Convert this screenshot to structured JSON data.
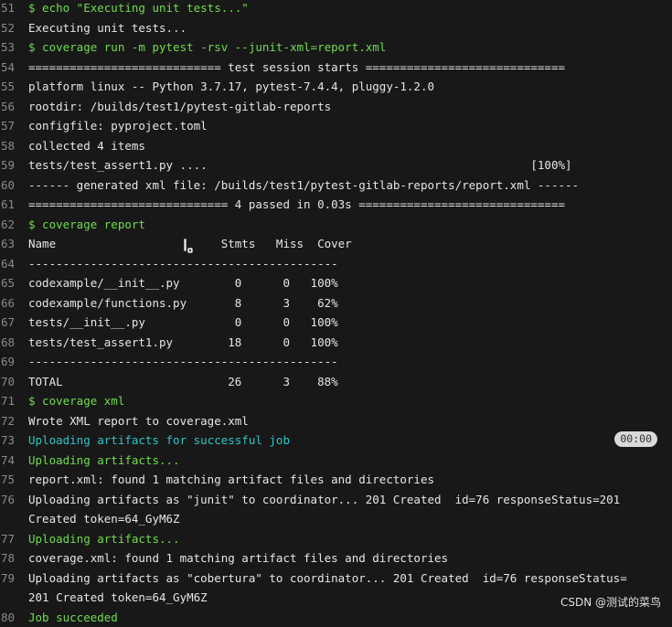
{
  "log": {
    "lines": [
      {
        "no": "51",
        "text": "$ echo \"Executing unit tests...\"",
        "style": "green"
      },
      {
        "no": "52",
        "text": "Executing unit tests...",
        "style": ""
      },
      {
        "no": "53",
        "text": "$ coverage run -m pytest -rsv --junit-xml=report.xml",
        "style": "green"
      },
      {
        "no": "54",
        "text": "============================ test session starts =============================",
        "style": ""
      },
      {
        "no": "55",
        "text": "platform linux -- Python 3.7.17, pytest-7.4.4, pluggy-1.2.0",
        "style": ""
      },
      {
        "no": "56",
        "text": "rootdir: /builds/test1/pytest-gitlab-reports",
        "style": ""
      },
      {
        "no": "57",
        "text": "configfile: pyproject.toml",
        "style": ""
      },
      {
        "no": "58",
        "text": "collected 4 items",
        "style": ""
      },
      {
        "no": "59",
        "text": "tests/test_assert1.py ....                                               [100%]",
        "style": ""
      },
      {
        "no": "60",
        "text": "------ generated xml file: /builds/test1/pytest-gitlab-reports/report.xml ------",
        "style": ""
      },
      {
        "no": "61",
        "text": "============================= 4 passed in 0.03s ==============================",
        "style": ""
      },
      {
        "no": "62",
        "text": "$ coverage report",
        "style": "green"
      },
      {
        "no": "63",
        "text": "Name                        Stmts   Miss  Cover",
        "style": ""
      },
      {
        "no": "64",
        "text": "---------------------------------------------",
        "style": ""
      },
      {
        "no": "65",
        "text": "codexample/__init__.py        0      0   100%",
        "style": ""
      },
      {
        "no": "66",
        "text": "codexample/functions.py       8      3    62%",
        "style": ""
      },
      {
        "no": "67",
        "text": "tests/__init__.py             0      0   100%",
        "style": ""
      },
      {
        "no": "68",
        "text": "tests/test_assert1.py        18      0   100%",
        "style": ""
      },
      {
        "no": "69",
        "text": "---------------------------------------------",
        "style": ""
      },
      {
        "no": "70",
        "text": "TOTAL                        26      3    88%",
        "style": ""
      },
      {
        "no": "71",
        "text": "$ coverage xml",
        "style": "green"
      },
      {
        "no": "72",
        "text": "Wrote XML report to coverage.xml",
        "style": ""
      },
      {
        "no": "73",
        "text": "Uploading artifacts for successful job",
        "style": "cyan",
        "badge": "00:00"
      },
      {
        "no": "74",
        "text": "Uploading artifacts...",
        "style": "green"
      },
      {
        "no": "75",
        "text": "report.xml: found 1 matching artifact files and directories",
        "style": ""
      },
      {
        "no": "76",
        "text": "Uploading artifacts as \"junit\" to coordinator... 201 Created  id=76 responseStatus=201",
        "style": ""
      },
      {
        "no": "",
        "text": "Created token=64_GyM6Z",
        "style": ""
      },
      {
        "no": "77",
        "text": "Uploading artifacts...",
        "style": "green"
      },
      {
        "no": "78",
        "text": "coverage.xml: found 1 matching artifact files and directories",
        "style": ""
      },
      {
        "no": "79",
        "text": "Uploading artifacts as \"cobertura\" to coordinator... 201 Created  id=76 responseStatus=",
        "style": ""
      },
      {
        "no": "",
        "text": "201 Created token=64_GyM6Z",
        "style": ""
      },
      {
        "no": "80",
        "text": "Job succeeded",
        "style": "green"
      }
    ]
  },
  "watermark": "CSDN @测试的菜鸟",
  "colors": {
    "background": "#181818",
    "command": "#6fdc4f",
    "section": "#2ec4c6",
    "line_number": "#8a8a8a"
  },
  "icons": {
    "cursor": "text-cursor-icon"
  }
}
